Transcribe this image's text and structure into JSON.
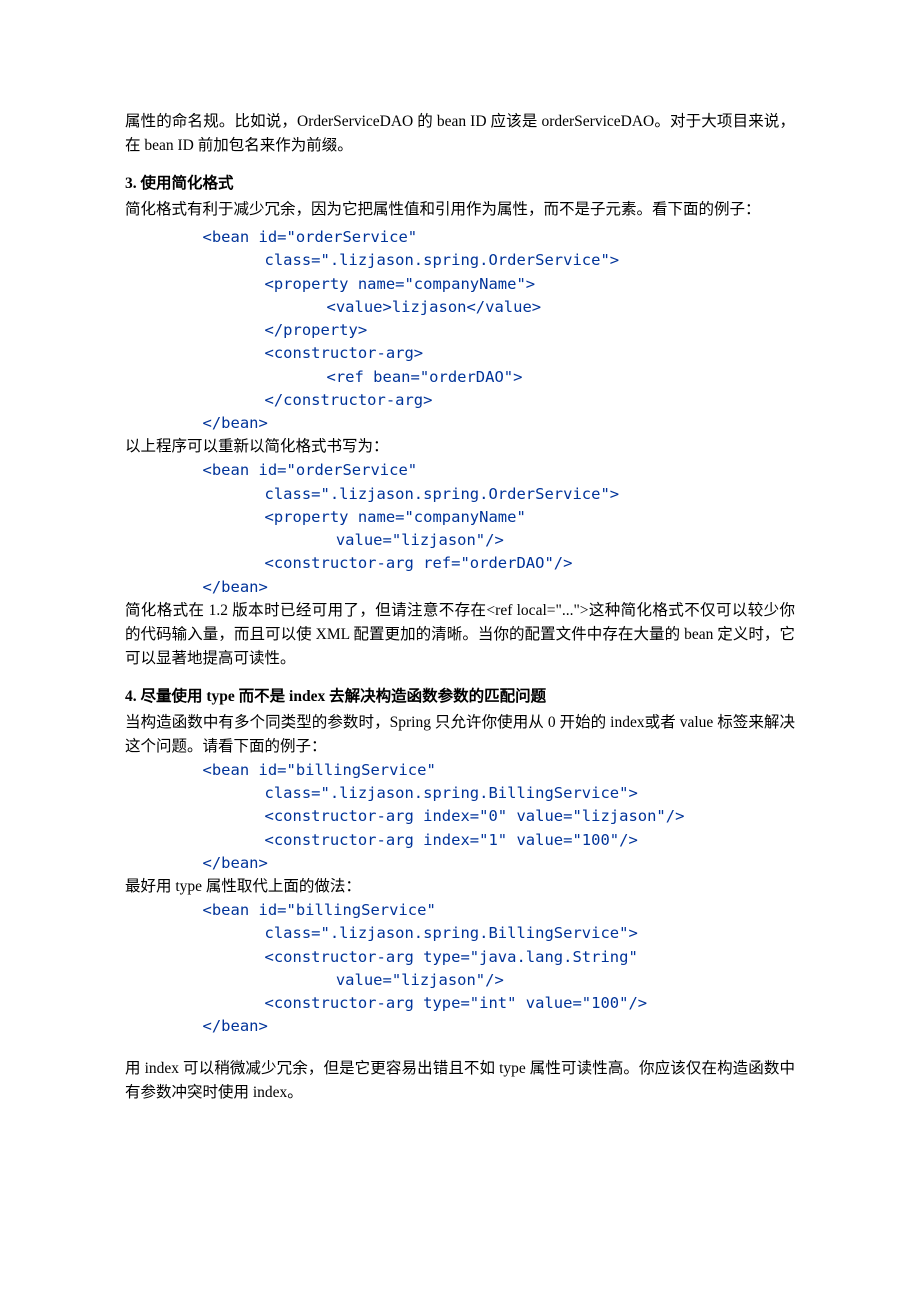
{
  "p1": "属性的命名规。比如说，OrderServiceDAO 的 bean ID 应该是 orderServiceDAO。对于大项目来说，在 bean ID 前加包名来作为前缀。",
  "h3": "3. 使用简化格式",
  "p2": "简化格式有利于减少冗余，因为它把属性值和引用作为属性，而不是子元素。看下面的例子：",
  "c1_1": "<bean id=\"orderService\"",
  "c1_2": "class=\".lizjason.spring.OrderService\">",
  "c1_3": "<property name=\"companyName\">",
  "c1_4": "<value>lizjason</value>",
  "c1_5": "</property>",
  "c1_6": "<constructor-arg>",
  "c1_7": "<ref bean=\"orderDAO\">",
  "c1_8": "</constructor-arg>",
  "c1_9": "</bean>",
  "p3": "以上程序可以重新以简化格式书写为：",
  "c2_1": "<bean id=\"orderService\"",
  "c2_2": "class=\".lizjason.spring.OrderService\">",
  "c2_3": "<property name=\"companyName\"",
  "c2_4": " value=\"lizjason\"/>",
  "c2_5": "<constructor-arg ref=\"orderDAO\"/>",
  "c2_6": "</bean>",
  "p4": "简化格式在 1.2 版本时已经可用了，但请注意不存在<ref local=\"...\">这种简化格式不仅可以较少你的代码输入量，而且可以使 XML 配置更加的清晰。当你的配置文件中存在大量的 bean 定义时，它可以显著地提高可读性。",
  "h4": "4. 尽量使用 type 而不是 index 去解决构造函数参数的匹配问题",
  "p5": "当构造函数中有多个同类型的参数时，Spring 只允许你使用从 0 开始的 index或者 value 标签来解决这个问题。请看下面的例子：",
  "c3_1": "<bean id=\"billingService\"",
  "c3_2": "class=\".lizjason.spring.BillingService\">",
  "c3_3": "<constructor-arg index=\"0\" value=\"lizjason\"/>",
  "c3_4": "<constructor-arg index=\"1\" value=\"100\"/>",
  "c3_5": "</bean>",
  "p6": "最好用 type 属性取代上面的做法：",
  "c4_1": "<bean id=\"billingService\"",
  "c4_2": "class=\".lizjason.spring.BillingService\">",
  "c4_3": "<constructor-arg type=\"java.lang.String\"",
  "c4_4": " value=\"lizjason\"/>",
  "c4_5": "<constructor-arg type=\"int\" value=\"100\"/>",
  "c4_6": "</bean>",
  "p7": "用 index 可以稍微减少冗余，但是它更容易出错且不如 type 属性可读性高。你应该仅在构造函数中有参数冲突时使用 index。"
}
